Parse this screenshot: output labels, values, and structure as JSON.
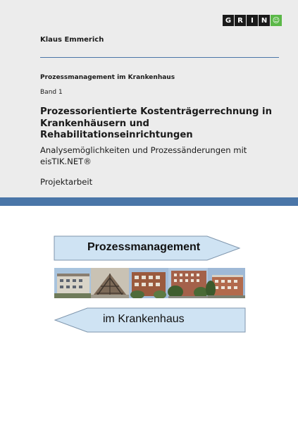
{
  "publisher": {
    "logo_letters": [
      "G",
      "R",
      "I",
      "N",
      "☺"
    ]
  },
  "cover": {
    "author": "Klaus Emmerich",
    "series": "Prozessmanagement im Krankenhaus",
    "volume": "Band 1",
    "title": "Prozessorientierte Kostenträgerrechnung in Krankenhäusern und Rehabilitationseinrichtungen",
    "subtitle": "Analysemöglichkeiten und Prozessänderungen mit eisTIK.NET®",
    "doc_type": "Projektarbeit"
  },
  "illustration": {
    "arrow_top_label": "Prozessmanagement",
    "arrow_bottom_label": "im Krankenhaus"
  },
  "colors": {
    "panel_background": "#ececec",
    "accent_blue": "#4a76a8",
    "arrow_fill": "#cfe3f3",
    "arrow_stroke": "#7f96ad",
    "logo_green": "#5bb848"
  }
}
